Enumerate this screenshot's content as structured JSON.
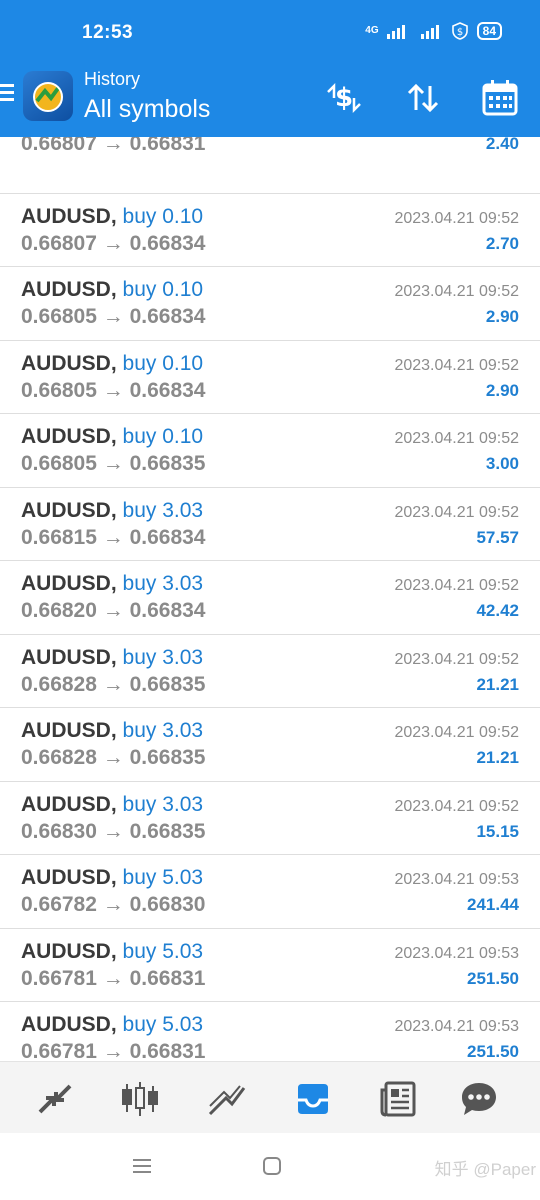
{
  "status_bar": {
    "time": "12:53",
    "network": "4G",
    "battery": "84"
  },
  "header": {
    "subtitle": "History",
    "title": "All symbols"
  },
  "colors": {
    "app_bar": "#1e88e5",
    "buy": "#1f7fd1",
    "profit": "#1f7fd1",
    "price": "#8a8a8a"
  },
  "partial_row": {
    "prices": "0.66807 → 0.66831",
    "profit": "2.40"
  },
  "trades": [
    {
      "symbol": "AUDUSD,",
      "direction": "buy 0.10",
      "time": "2023.04.21 09:52",
      "prices": "0.66807 → 0.66834",
      "profit": "2.70"
    },
    {
      "symbol": "AUDUSD,",
      "direction": "buy 0.10",
      "time": "2023.04.21 09:52",
      "prices": "0.66805 → 0.66834",
      "profit": "2.90"
    },
    {
      "symbol": "AUDUSD,",
      "direction": "buy 0.10",
      "time": "2023.04.21 09:52",
      "prices": "0.66805 → 0.66834",
      "profit": "2.90"
    },
    {
      "symbol": "AUDUSD,",
      "direction": "buy 0.10",
      "time": "2023.04.21 09:52",
      "prices": "0.66805 → 0.66835",
      "profit": "3.00"
    },
    {
      "symbol": "AUDUSD,",
      "direction": "buy 3.03",
      "time": "2023.04.21 09:52",
      "prices": "0.66815 → 0.66834",
      "profit": "57.57"
    },
    {
      "symbol": "AUDUSD,",
      "direction": "buy 3.03",
      "time": "2023.04.21 09:52",
      "prices": "0.66820 → 0.66834",
      "profit": "42.42"
    },
    {
      "symbol": "AUDUSD,",
      "direction": "buy 3.03",
      "time": "2023.04.21 09:52",
      "prices": "0.66828 → 0.66835",
      "profit": "21.21"
    },
    {
      "symbol": "AUDUSD,",
      "direction": "buy 3.03",
      "time": "2023.04.21 09:52",
      "prices": "0.66828 → 0.66835",
      "profit": "21.21"
    },
    {
      "symbol": "AUDUSD,",
      "direction": "buy 3.03",
      "time": "2023.04.21 09:52",
      "prices": "0.66830 → 0.66835",
      "profit": "15.15"
    },
    {
      "symbol": "AUDUSD,",
      "direction": "buy 5.03",
      "time": "2023.04.21 09:53",
      "prices": "0.66782 → 0.66830",
      "profit": "241.44"
    },
    {
      "symbol": "AUDUSD,",
      "direction": "buy 5.03",
      "time": "2023.04.21 09:53",
      "prices": "0.66781 → 0.66831",
      "profit": "251.50"
    },
    {
      "symbol": "AUDUSD,",
      "direction": "buy 5.03",
      "time": "2023.04.21 09:53",
      "prices": "0.66781 → 0.66831",
      "profit": "251.50"
    }
  ],
  "bottom_nav": [
    {
      "icon": "quotes-icon"
    },
    {
      "icon": "chart-icon"
    },
    {
      "icon": "trade-icon"
    },
    {
      "icon": "history-icon",
      "active": true
    },
    {
      "icon": "news-icon"
    },
    {
      "icon": "chat-icon"
    }
  ],
  "watermark": "知乎 @Paper"
}
